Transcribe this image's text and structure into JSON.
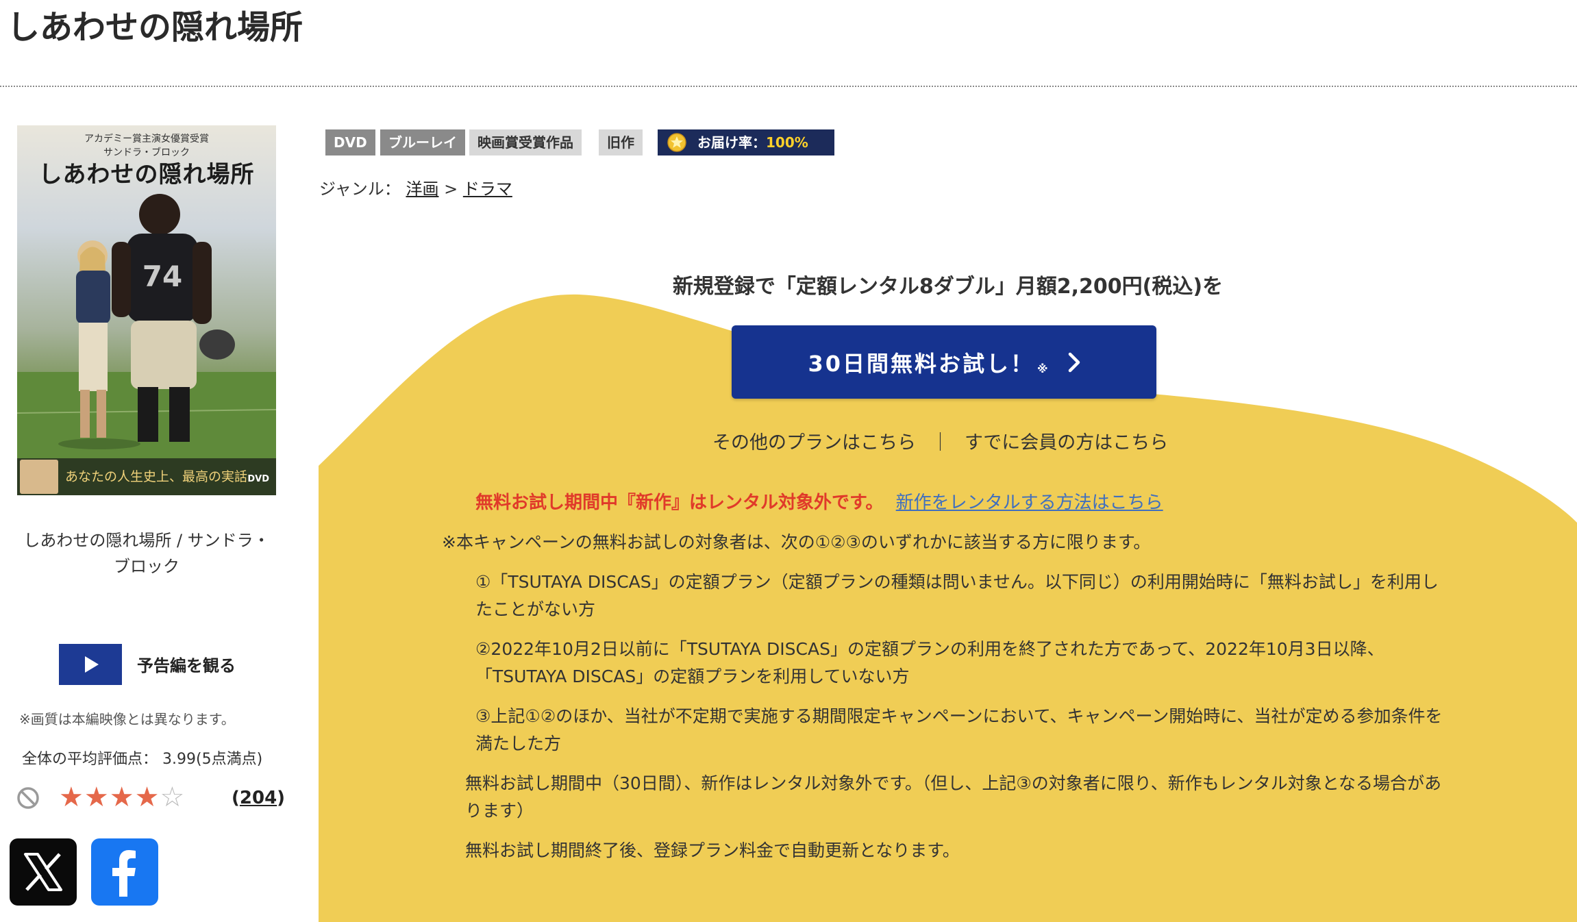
{
  "page": {
    "title": "しあわせの隠れ場所"
  },
  "poster": {
    "top_text_line1": "アカデミー賞主演女優賞受賞",
    "top_text_line2": "サンドラ・ブロック",
    "title": "しあわせの隠れ場所",
    "jersey_number": "74",
    "tagline": "あなたの人生史上、最高の実話",
    "format_mark": "DVD"
  },
  "work": {
    "caption_line1": "しあわせの隠れ場所 / サンドラ・",
    "caption_line2": "ブロック"
  },
  "trailer": {
    "label": "予告編を観る"
  },
  "image_note": "※画質は本編映像とは異なります。",
  "rating": {
    "label": "全体の平均評価点：",
    "value": "3.99(5点満点)",
    "stars_filled": 4,
    "stars_total": 5,
    "review_count": "204"
  },
  "share": {
    "x_icon": "x-logo-icon",
    "facebook_icon": "facebook-logo-icon"
  },
  "tags": {
    "dvd": "DVD",
    "bluray": "ブルーレイ",
    "award": "映画賞受賞作品",
    "old": "旧作",
    "delivery_label": "お届け率：",
    "delivery_rate": "100%"
  },
  "genre": {
    "label": "ジャンル：",
    "parent": "洋画",
    "separator": ">",
    "child": "ドラマ"
  },
  "campaign": {
    "headline": "新規登録で「定額レンタル8ダブル」月額2,200円(税込)を",
    "button_label": "30日間無料お試し！",
    "button_mark": "※",
    "other_plans": "その他のプランはこちら",
    "link_separator": "｜",
    "members_link": "すでに会員の方はこちら",
    "warning": "無料お試し期間中『新作』はレンタル対象外です。",
    "howto_link": "新作をレンタルする方法はこちら",
    "eligibility_intro": "※本キャンペーンの無料お試しの対象者は、次の①②③のいずれかに該当する方に限ります。",
    "condition1": "①「TSUTAYA DISCAS」の定額プラン（定額プランの種類は問いません。以下同じ）の利用開始時に「無料お試し」を利用したことがない方",
    "condition2": "②2022年10月2日以前に「TSUTAYA DISCAS」の定額プランの利用を終了された方であって、2022年10月3日以降、「TSUTAYA DISCAS」の定額プランを利用していない方",
    "condition3": "③上記①②のほか、当社が不定期で実施する期間限定キャンペーンにおいて、キャンペーン開始時に、当社が定める参加条件を満たした方",
    "trial_note": "無料お試し期間中（30日間）、新作はレンタル対象外です。（但し、上記③の対象者に限り、新作もレンタル対象となる場合があります）",
    "renewal_note": "無料お試し期間終了後、登録プラン料金で自動更新となります。"
  },
  "colors": {
    "campaign_bg": "#f0cd55",
    "button_blue": "#16338f",
    "warning_red": "#e03a2a",
    "link_blue": "#3f6fbf",
    "delivery_bg": "#1c2b5a",
    "star": "#e5684a"
  }
}
